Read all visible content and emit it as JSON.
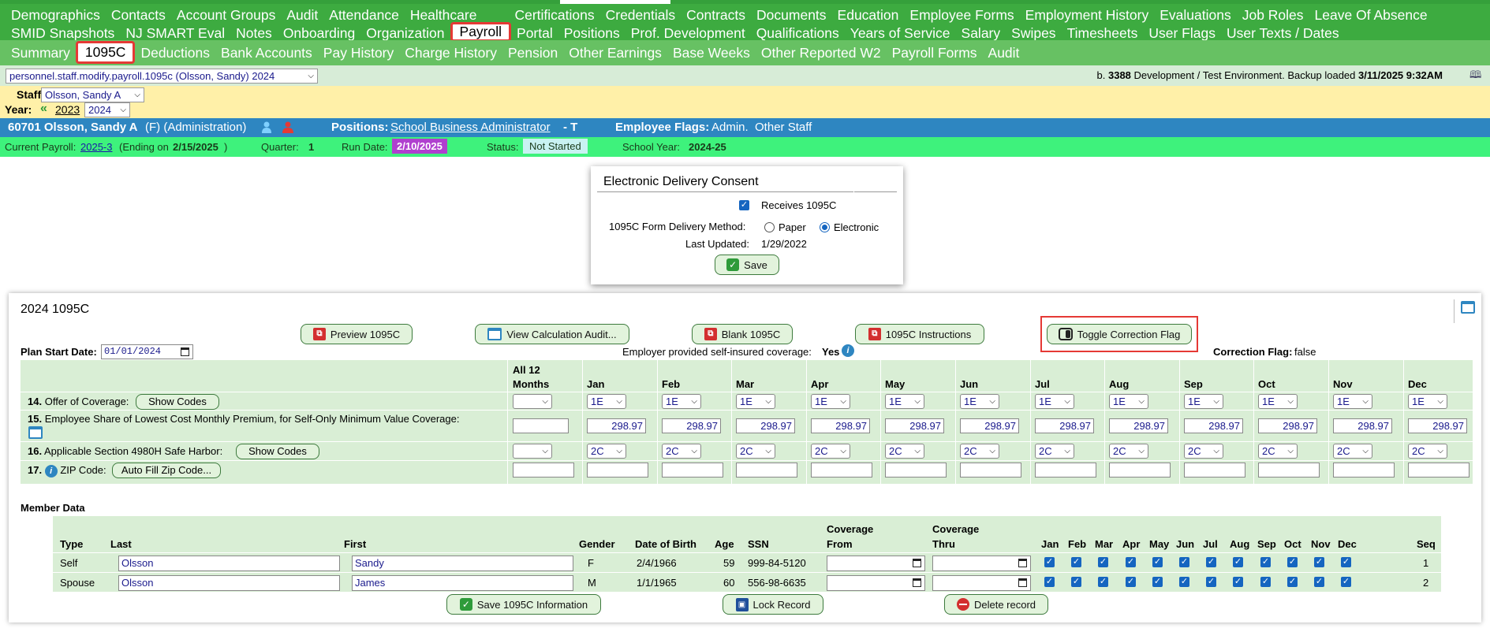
{
  "nav_row1": [
    "Demographics",
    "Contacts",
    "Account Groups",
    "Audit",
    "Attendance",
    "Healthcare",
    "Certifications",
    "Credentials",
    "Contracts",
    "Documents",
    "Education",
    "Employee Forms",
    "Employment History",
    "Evaluations",
    "Job Roles",
    "Leave Of Absence"
  ],
  "nav_row2": [
    "SMID Snapshots",
    "NJ SMART Eval",
    "Notes",
    "Onboarding",
    "Organization",
    "Payroll",
    "Portal",
    "Positions",
    "Prof. Development",
    "Qualifications",
    "Years of Service",
    "Salary",
    "Swipes",
    "Timesheets",
    "User Flags",
    "User Texts / Dates"
  ],
  "nav_row3": [
    "Summary",
    "1095C",
    "Deductions",
    "Bank Accounts",
    "Pay History",
    "Charge History",
    "Pension",
    "Other Earnings",
    "Base Weeks",
    "Other Reported W2",
    "Payroll Forms",
    "Audit"
  ],
  "page_select": "personnel.staff.modify.payroll.1095c (Olsson, Sandy) 2024",
  "env": {
    "prefix": "b.",
    "build": "3388",
    "text": "Development / Test Environment. Backup loaded",
    "date": "3/11/2025 9:32AM"
  },
  "staff": {
    "label": "Staff:",
    "value": "Olsson, Sandy A"
  },
  "year": {
    "label": "Year:",
    "prev_icon": "«",
    "prev": "2023",
    "value": "2024"
  },
  "employee": {
    "id_name": "60701 Olsson, Sandy A",
    "detail": "(F) (Administration)",
    "positions_label": "Positions:",
    "position": "School Business Administrator",
    "position_suffix": "- T",
    "flags_label": "Employee Flags:",
    "flags": "Admin.  Other Staff"
  },
  "payroll": {
    "current_label": "Current Payroll:",
    "current": "2025-3",
    "ending": "(Ending on",
    "ending_date": "2/15/2025",
    "ending_close": ")",
    "quarter_label": "Quarter:",
    "quarter": "1",
    "run_label": "Run Date:",
    "run_date": "2/10/2025",
    "status_label": "Status:",
    "status": "Not Started",
    "school_label": "School Year:",
    "school_year": "2024-25",
    "run_color": "#b03fcf",
    "status_color": "#c9f2f2"
  },
  "consent": {
    "title": "Electronic Delivery Consent",
    "receives": "Receives 1095C",
    "method_label": "1095C Form Delivery Method:",
    "paper": "Paper",
    "electronic": "Electronic",
    "updated_label": "Last Updated:",
    "updated": "1/29/2022",
    "save": "Save"
  },
  "form": {
    "title": "2024 1095C",
    "buttons": [
      "Preview 1095C",
      "View Calculation Audit...",
      "Blank 1095C",
      "1095C Instructions",
      "Toggle Correction Flag"
    ],
    "plan_start_label": "Plan Start Date:",
    "plan_start": "01/01/2024",
    "employer_cov_label": "Employer provided self-insured coverage:",
    "employer_cov": "Yes",
    "correction_label": "Correction Flag:",
    "correction": "false",
    "all12": "All 12",
    "months_label": "Months",
    "months": [
      "Jan",
      "Feb",
      "Mar",
      "Apr",
      "May",
      "Jun",
      "Jul",
      "Aug",
      "Sep",
      "Oct",
      "Nov",
      "Dec"
    ],
    "row14_num": "14.",
    "row14_label": "Offer of Coverage:",
    "show_codes": "Show Codes",
    "offer_codes": [
      "1E",
      "1E",
      "1E",
      "1E",
      "1E",
      "1E",
      "1E",
      "1E",
      "1E",
      "1E",
      "1E",
      "1E"
    ],
    "row15_num": "15.",
    "row15_label": "Employee Share of Lowest Cost Monthly Premium, for Self-Only Minimum Value Coverage:",
    "premiums": [
      "298.97",
      "298.97",
      "298.97",
      "298.97",
      "298.97",
      "298.97",
      "298.97",
      "298.97",
      "298.97",
      "298.97",
      "298.97",
      "298.97"
    ],
    "row16_num": "16.",
    "row16_label": "Applicable Section 4980H Safe Harbor:",
    "harbor_codes": [
      "2C",
      "2C",
      "2C",
      "2C",
      "2C",
      "2C",
      "2C",
      "2C",
      "2C",
      "2C",
      "2C",
      "2C"
    ],
    "row17_num": "17.",
    "row17_label": "ZIP Code:",
    "autofill": "Auto Fill Zip Code..."
  },
  "member": {
    "title": "Member Data",
    "headers": {
      "type": "Type",
      "last": "Last",
      "first": "First",
      "gender": "Gender",
      "dob": "Date of Birth",
      "age": "Age",
      "ssn": "SSN",
      "cov_from_1": "Coverage",
      "cov_from_2": "From",
      "cov_thru_1": "Coverage",
      "cov_thru_2": "Thru",
      "seq": "Seq"
    },
    "rows": [
      {
        "type": "Self",
        "last": "Olsson",
        "first": "Sandy",
        "gender": "F",
        "dob": "2/4/1966",
        "age": "59",
        "ssn": "999-84-5120",
        "seq": "1"
      },
      {
        "type": "Spouse",
        "last": "Olsson",
        "first": "James",
        "gender": "M",
        "dob": "1/1/1965",
        "age": "60",
        "ssn": "556-98-6635",
        "seq": "2"
      }
    ],
    "save": "Save 1095C Information",
    "lock": "Lock Record",
    "delete": "Delete record"
  }
}
